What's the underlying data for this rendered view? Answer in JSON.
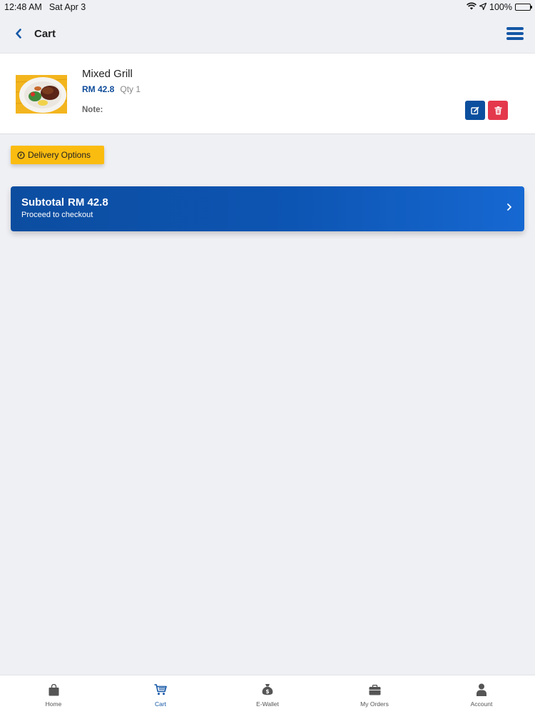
{
  "status_bar": {
    "time": "12:48 AM",
    "date": "Sat Apr 3",
    "battery": "100%"
  },
  "header": {
    "title": "Cart"
  },
  "cart_items": [
    {
      "name": "Mixed Grill",
      "price": "RM 42.8",
      "qty": "Qty 1",
      "note_label": "Note:"
    }
  ],
  "delivery_options": {
    "label": "Delivery Options"
  },
  "checkout": {
    "subtotal_label": "Subtotal",
    "subtotal_value": "RM 42.8",
    "action_label": "Proceed to checkout"
  },
  "tabs": [
    {
      "label": "Home",
      "icon": "shopping-bag-icon"
    },
    {
      "label": "Cart",
      "icon": "cart-icon",
      "active": true
    },
    {
      "label": "E-Wallet",
      "icon": "money-bag-icon"
    },
    {
      "label": "My Orders",
      "icon": "briefcase-icon"
    },
    {
      "label": "Account",
      "icon": "user-icon"
    }
  ],
  "colors": {
    "primary": "#0c4f9e",
    "accent_yellow": "#fbbc10",
    "danger": "#e4384c",
    "background": "#eff0f4"
  }
}
